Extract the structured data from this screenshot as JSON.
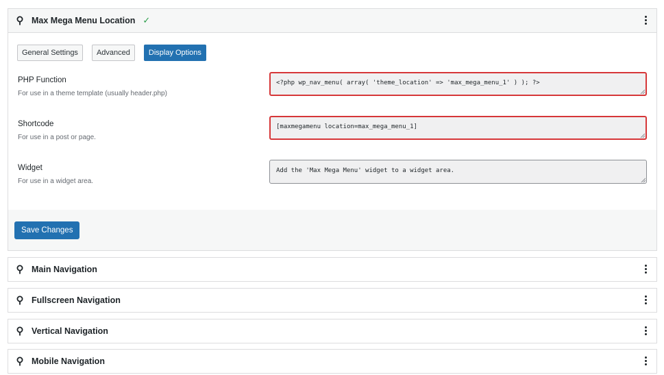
{
  "open_panel": {
    "title": "Max Mega Menu Location",
    "status_check": "✓",
    "tabs": [
      "General Settings",
      "Advanced",
      "Display Options"
    ],
    "active_tab": "Display Options",
    "fields": [
      {
        "label": "PHP Function",
        "description": "For use in a theme template (usually header.php)",
        "value": "<?php wp_nav_menu( array( 'theme_location' => 'max_mega_menu_1' ) ); ?>",
        "highlighted": true
      },
      {
        "label": "Shortcode",
        "description": "For use in a post or page.",
        "value": "[maxmegamenu location=max_mega_menu_1]",
        "highlighted": true
      },
      {
        "label": "Widget",
        "description": "For use in a widget area.",
        "value": "Add the 'Max Mega Menu' widget to a widget area.",
        "highlighted": false
      }
    ],
    "save_label": "Save Changes"
  },
  "collapsed_panels": [
    {
      "title": "Main Navigation"
    },
    {
      "title": "Fullscreen Navigation"
    },
    {
      "title": "Vertical Navigation"
    },
    {
      "title": "Mobile Navigation"
    }
  ],
  "colors": {
    "accent": "#2271b1",
    "highlight_border": "#d63638",
    "check": "#2a9d4a"
  },
  "icons": {
    "location": "map-pin-icon",
    "menu": "more-vertical-icon"
  }
}
